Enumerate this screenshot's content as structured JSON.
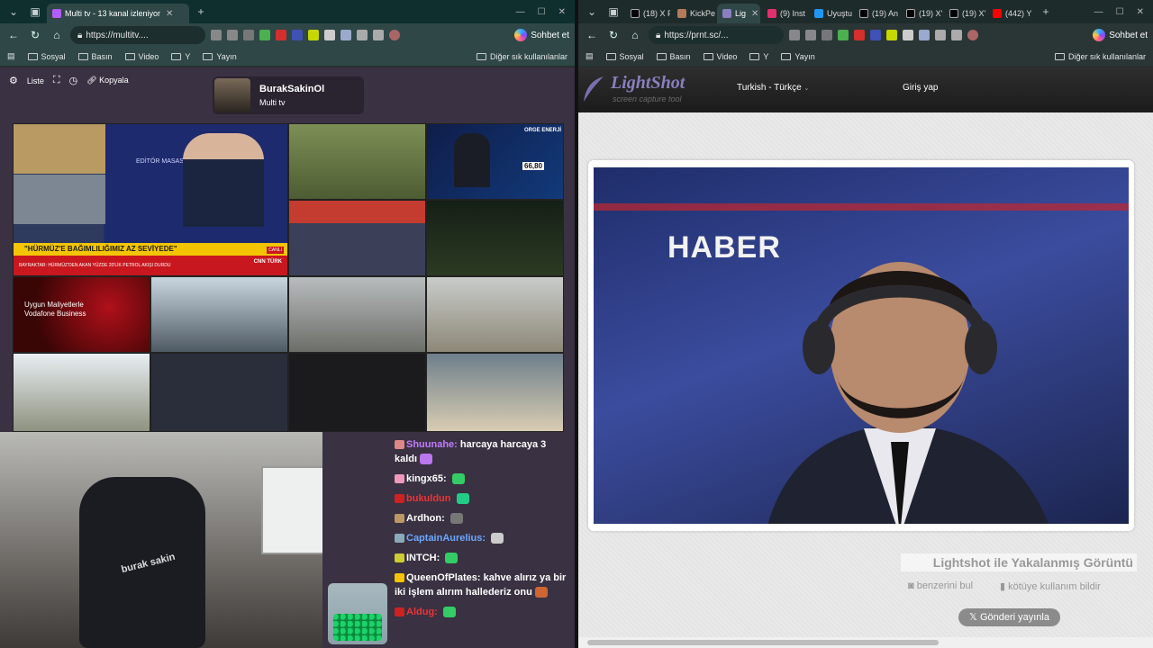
{
  "left_window": {
    "tab_title": "Multi tv - 13 kanal izleniyor",
    "url": "https://multitv....",
    "chat_button": "Sohbet et",
    "bookmarks": [
      "Sosyal",
      "Basın",
      "Video",
      "Y",
      "Yayın"
    ],
    "bookmarks_other": "Diğer sık kullanılanlar",
    "toolbar": {
      "list_label": "Liste",
      "copy_label": "Kopyala"
    },
    "profile": {
      "name": "BurakSakinOl",
      "subtitle": "Multi tv"
    },
    "news": {
      "editor_label": "EDİTÖR MASASI",
      "headline": "\"HÜRMÜZ'E BAĞIMLILIĞIMIZ AZ SEVİYEDE\"",
      "subline": "BAYRAKTAR: HÜRMÜZ'DEN AKAN YÜZDE 20'LİK PETROL AKIŞI DURDU",
      "live": "CANLI",
      "channel": "CNN TÜRK"
    },
    "vodafone_ad": "Uygun Maliyetlerle Vodafone Business",
    "market_tile": {
      "label": "ORGE ENERJİ",
      "price": "66,80"
    },
    "chair_logo": "burak sakin",
    "chat": [
      {
        "user": "Shuunahe:",
        "user_color": "#c27bff",
        "text": "harcaya harcaya 3 kaldı"
      },
      {
        "user": "kingx65:",
        "user_color": "#ffffff",
        "text": ""
      },
      {
        "user": "bukuldun",
        "user_color": "#e33",
        "text": ""
      },
      {
        "user": "Ardhon:",
        "user_color": "#ffffff",
        "text": ""
      },
      {
        "user": "CaptainAurelius:",
        "user_color": "#6aa8ff",
        "text": ""
      },
      {
        "user": "INTCH:",
        "user_color": "#ffffff",
        "text": ""
      },
      {
        "user": "QueenOfPlates:",
        "user_color": "#ffffff",
        "text": "kahve alırız ya bir iki işlem alırım hallederiz onu"
      },
      {
        "user": "Aldug:",
        "user_color": "#e33",
        "text": ""
      }
    ]
  },
  "right_window": {
    "tabs": [
      "(18) X F",
      "KickPe",
      "Lig",
      "(9) Inst",
      "Uyuştu",
      "(19) An",
      "(19) X'",
      "(19) X'",
      "(442) Y"
    ],
    "url": "https://prnt.sc/...",
    "chat_button": "Sohbet et",
    "bookmarks": [
      "Sosyal",
      "Basın",
      "Video",
      "Y",
      "Yayın"
    ],
    "bookmarks_other": "Diğer sık kullanılanlar",
    "lightshot": {
      "logo": "LightShot",
      "tagline": "screen capture tool",
      "language": "Turkish - Türkçe",
      "login": "Giriş yap",
      "screenshot_text": "HABER",
      "title": "Lightshot ile Yakalanmış Görüntü",
      "similar": "benzerini bul",
      "report": "kötüye kullanım bildir",
      "share": "Gönderi yayınla"
    }
  }
}
